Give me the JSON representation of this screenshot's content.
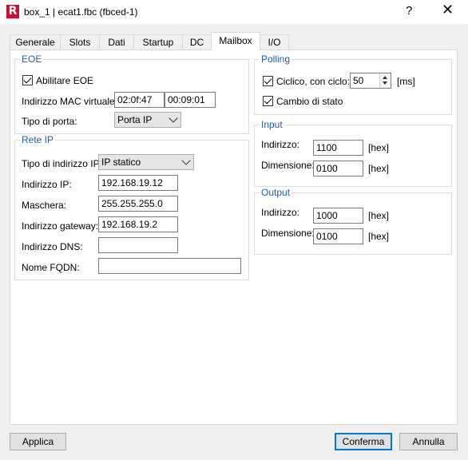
{
  "window": {
    "title": "box_1 | ecat1.fbc (fbced-1)",
    "help": "?",
    "close": "✕",
    "icon_letter": "R"
  },
  "tabs": [
    "Generale",
    "Slots",
    "Dati",
    "Startup",
    "DC",
    "Mailbox",
    "I/O"
  ],
  "active_tab": "Mailbox",
  "eoe": {
    "title": "EOE",
    "enable_label": "Abilitare EOE",
    "enable_checked": true,
    "mac_label": "Indirizzo MAC virtuale:",
    "mac_part1": "02:0f:47",
    "mac_part2": "00:09:01",
    "port_type_label": "Tipo di porta:",
    "port_type_value": "Porta IP"
  },
  "rete_ip": {
    "title": "Rete IP",
    "ip_type_label": "Tipo di indirizzo IP:",
    "ip_type_value": "IP statico",
    "ip_label": "Indirizzo IP:",
    "ip_value": "192.168.19.12",
    "mask_label": "Maschera:",
    "mask_value": "255.255.255.0",
    "gateway_label": "Indirizzo gateway:",
    "gateway_value": "192.168.19.2",
    "dns_label": "Indirizzo DNS:",
    "dns_value": "",
    "fqdn_label": "Nome FQDN:",
    "fqdn_value": ""
  },
  "polling": {
    "title": "Polling",
    "cyclic_label": "Ciclico, con ciclo:",
    "cyclic_checked": true,
    "cycle_value": "50",
    "cycle_unit": "[ms]",
    "state_change_label": "Cambio di stato",
    "state_change_checked": true
  },
  "input": {
    "title": "Input",
    "address_label": "Indirizzo:",
    "address_value": "1100",
    "address_unit": "[hex]",
    "size_label": "Dimensione:",
    "size_value": "0100",
    "size_unit": "[hex]"
  },
  "output": {
    "title": "Output",
    "address_label": "Indirizzo:",
    "address_value": "1000",
    "address_unit": "[hex]",
    "size_label": "Dimensione:",
    "size_value": "0100",
    "size_unit": "[hex]"
  },
  "footer": {
    "apply": "Applica",
    "confirm": "Conferma",
    "cancel": "Annulla"
  },
  "colors": {
    "group_title": "#1f5fa8",
    "app_icon": "#c8102e",
    "default_button_border": "#0078d7"
  }
}
